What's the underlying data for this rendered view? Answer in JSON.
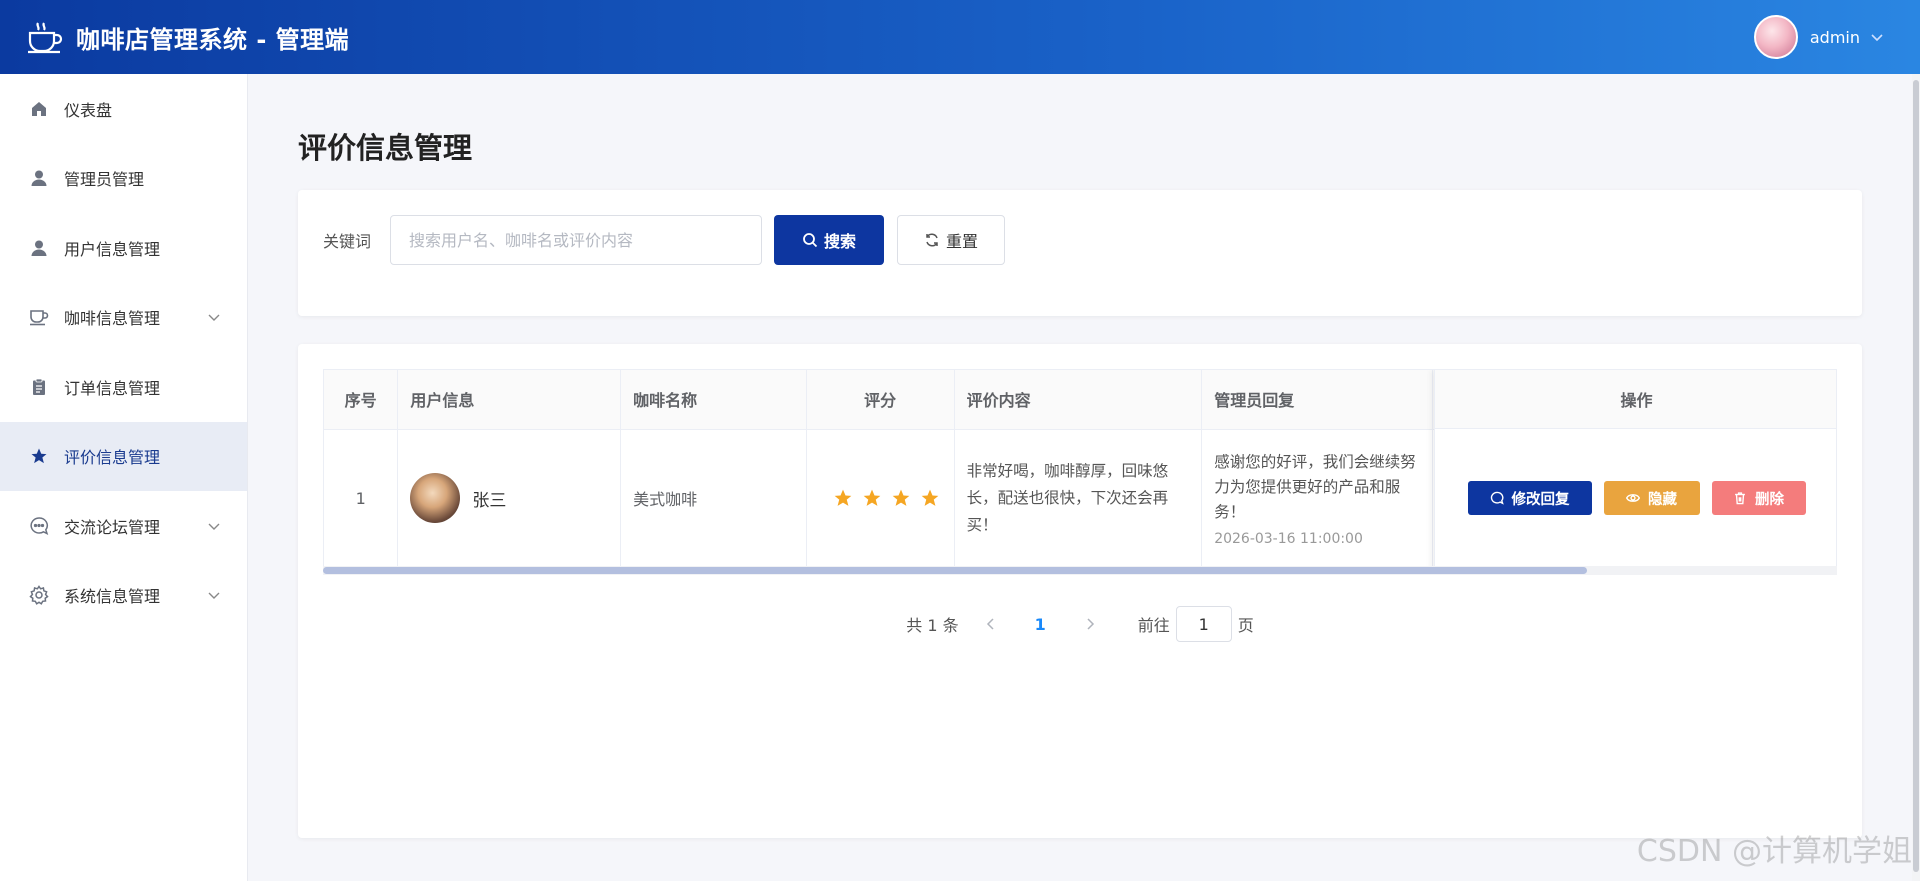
{
  "header": {
    "app_title": "咖啡店管理系统 - 管理端",
    "logo_icon": "coffee-cup-icon",
    "user": {
      "name": "admin"
    }
  },
  "sidebar": {
    "items": [
      {
        "label": "仪表盘",
        "icon": "home-icon",
        "active": false
      },
      {
        "label": "管理员管理",
        "icon": "user-icon",
        "active": false
      },
      {
        "label": "用户信息管理",
        "icon": "user-icon",
        "active": false
      },
      {
        "label": "咖啡信息管理",
        "icon": "coffee-icon",
        "active": false,
        "expandable": true
      },
      {
        "label": "订单信息管理",
        "icon": "clipboard-icon",
        "active": false
      },
      {
        "label": "评价信息管理",
        "icon": "star-icon",
        "active": true
      },
      {
        "label": "交流论坛管理",
        "icon": "chat-icon",
        "active": false,
        "expandable": true
      },
      {
        "label": "系统信息管理",
        "icon": "gear-icon",
        "active": false,
        "expandable": true
      }
    ]
  },
  "main": {
    "page_title": "评价信息管理",
    "search": {
      "label": "关键词",
      "placeholder": "搜索用户名、咖啡名或评价内容",
      "value": "",
      "search_button": "搜索",
      "reset_button": "重置"
    },
    "table": {
      "columns": [
        "序号",
        "用户信息",
        "咖啡名称",
        "评分",
        "评价内容",
        "管理员回复",
        "操作"
      ],
      "rows": [
        {
          "index": "1",
          "user_name": "张三",
          "coffee_name": "美式咖啡",
          "rating": 4,
          "review": "非常好喝，咖啡醇厚，回味悠长，配送也很快，下次还会再买！",
          "reply": "感谢您的好评，我们会继续努力为您提供更好的产品和服务！",
          "reply_time": "2026-03-16 11:00:00",
          "actions": {
            "reply": "修改回复",
            "hide": "隐藏",
            "delete": "删除"
          }
        }
      ],
      "horizontal_scroll_fraction": 0.835
    },
    "pagination": {
      "total_text": "共 1 条",
      "current_page": "1",
      "goto_label": "前往",
      "goto_value": "1",
      "page_suffix": "页"
    }
  },
  "watermark": "CSDN @计算机学姐",
  "colors": {
    "header_start": "#0b3aa0",
    "header_end": "#2a86e2",
    "primary": "#0d36a0",
    "warning": "#e9a43e",
    "danger": "#f47c7c",
    "star": "#f5a623",
    "active_link": "#1989fa"
  }
}
